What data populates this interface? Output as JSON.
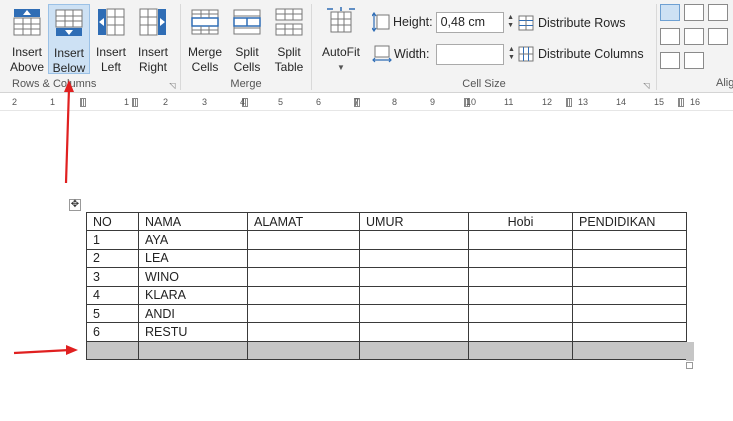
{
  "ribbon": {
    "rows_columns": {
      "label": "Rows & Columns",
      "insert_above": [
        "Insert",
        "Above"
      ],
      "insert_below": [
        "Insert",
        "Below"
      ],
      "insert_left": [
        "Insert",
        "Left"
      ],
      "insert_right": [
        "Insert",
        "Right"
      ]
    },
    "merge": {
      "label": "Merge",
      "merge_cells": [
        "Merge",
        "Cells"
      ],
      "split_cells": [
        "Split",
        "Cells"
      ],
      "split_table": [
        "Split",
        "Table"
      ]
    },
    "cell_size": {
      "label": "Cell Size",
      "autofit": "AutoFit",
      "height_label": "Height:",
      "height_value": "0,48 cm",
      "width_label": "Width:",
      "width_value": "",
      "distribute_rows": "Distribute Rows",
      "distribute_columns": "Distribute Columns"
    },
    "alignment": {
      "label_partial": "Alig"
    }
  },
  "ruler": {
    "numbers": [
      "2",
      "1",
      "1",
      "2",
      "3",
      "4",
      "5",
      "6",
      "7",
      "8",
      "9",
      "10",
      "11",
      "12",
      "13",
      "14",
      "15",
      "16"
    ]
  },
  "table": {
    "headers": [
      "NO",
      "NAMA",
      "ALAMAT",
      "UMUR",
      "Hobi",
      "PENDIDIKAN"
    ],
    "rows": [
      [
        "1",
        "AYA",
        "",
        "",
        "",
        ""
      ],
      [
        "2",
        "LEA",
        "",
        "",
        "",
        ""
      ],
      [
        "3",
        "WINO",
        "",
        "",
        "",
        ""
      ],
      [
        "4",
        "KLARA",
        "",
        "",
        "",
        ""
      ],
      [
        "5",
        "ANDI",
        "",
        "",
        "",
        ""
      ],
      [
        "6",
        "RESTU",
        "",
        "",
        "",
        ""
      ]
    ]
  },
  "colors": {
    "active_button": "#cde1f4",
    "selected_row": "#c6c6c6",
    "annotation_arrow": "#e02020",
    "icon_blue": "#2f6db5"
  }
}
